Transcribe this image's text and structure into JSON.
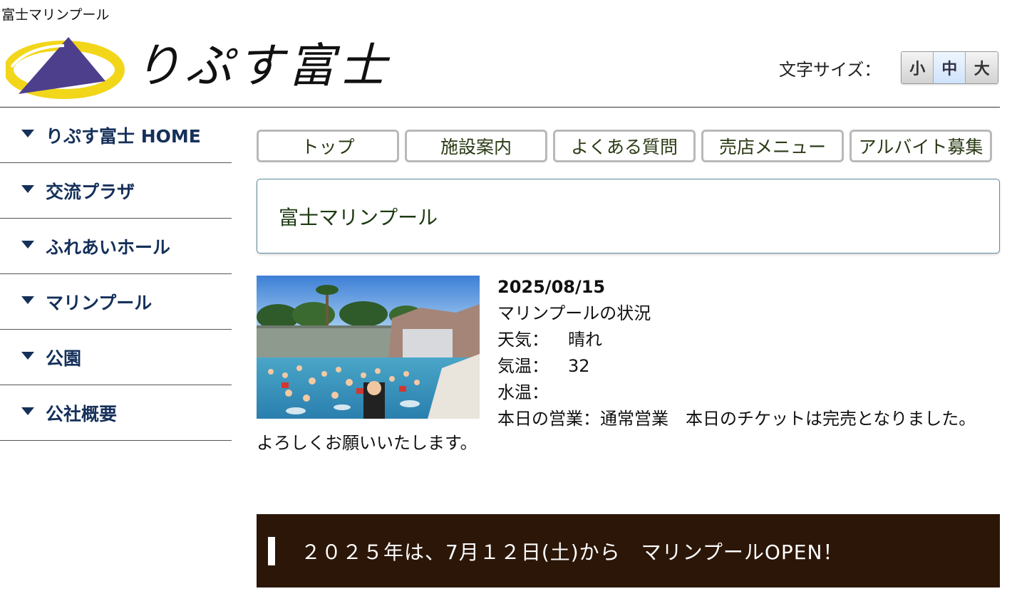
{
  "page": {
    "small_title": "富士マリンプール"
  },
  "header": {
    "logo_text": "りぷす富士",
    "logo_colors": {
      "mountain": "#4e3f8d",
      "ring": "#f2d61a"
    },
    "fontsize_label": "文字サイズ：",
    "fontsize_options": [
      "小",
      "中",
      "大"
    ],
    "fontsize_selected": "中"
  },
  "sidebar": {
    "items": [
      {
        "label": "りぷす富士 HOME"
      },
      {
        "label": "交流プラザ"
      },
      {
        "label": "ふれあいホール"
      },
      {
        "label": "マリンプール"
      },
      {
        "label": "公園"
      },
      {
        "label": "公社概要"
      }
    ]
  },
  "topnav": {
    "items": [
      {
        "label": "トップ"
      },
      {
        "label": "施設案内"
      },
      {
        "label": "よくある質問"
      },
      {
        "label": "売店メニュー"
      },
      {
        "label": "アルバイト募集"
      }
    ]
  },
  "section": {
    "title": "富士マリンプール"
  },
  "report": {
    "date": "2025/08/15",
    "heading": "マリンプールの状況",
    "weather_key": "天気：",
    "weather_value": "晴れ",
    "air_temp_key": "気温：",
    "air_temp_value": "32",
    "water_temp_key": "水温：",
    "water_temp_value": "",
    "status": "本日の営業：通常営業　本日のチケットは完売となりました。",
    "closing": "よろしくお願いいたします。"
  },
  "banner": {
    "text": "２０２５年は、7月１２日(土)から　マリンプールOPEN！",
    "background": "#2b1608"
  }
}
